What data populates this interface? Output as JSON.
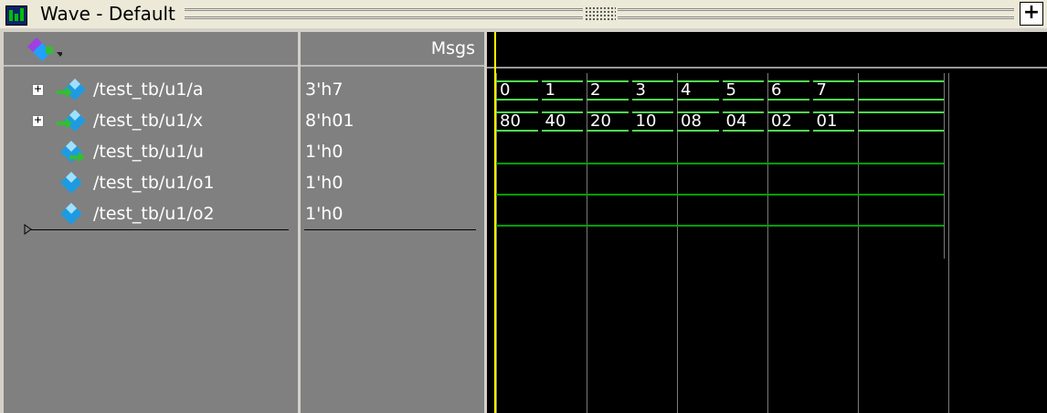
{
  "window": {
    "title": "Wave - Default",
    "add_button_label": "+"
  },
  "header": {
    "msgs_label": "Msgs"
  },
  "signals": [
    {
      "name": "/test_tb/u1/a",
      "value": "3'h7",
      "expandable": true,
      "kind": "bus"
    },
    {
      "name": "/test_tb/u1/x",
      "value": "8'h01",
      "expandable": true,
      "kind": "bus"
    },
    {
      "name": "/test_tb/u1/u",
      "value": "1'h0",
      "expandable": false,
      "kind": "input"
    },
    {
      "name": "/test_tb/u1/o1",
      "value": "1'h0",
      "expandable": false,
      "kind": "wire"
    },
    {
      "name": "/test_tb/u1/o2",
      "value": "1'h0",
      "expandable": false,
      "kind": "wire"
    }
  ],
  "waves": {
    "a": [
      "0",
      "1",
      "2",
      "3",
      "4",
      "5",
      "6",
      "7"
    ],
    "x": [
      "80",
      "40",
      "20",
      "10",
      "08",
      "04",
      "02",
      "01"
    ]
  },
  "colors": {
    "wave": "#50e050",
    "low": "#00a000",
    "cursor": "#ffff00",
    "background": "#000000",
    "pane": "#808080"
  }
}
